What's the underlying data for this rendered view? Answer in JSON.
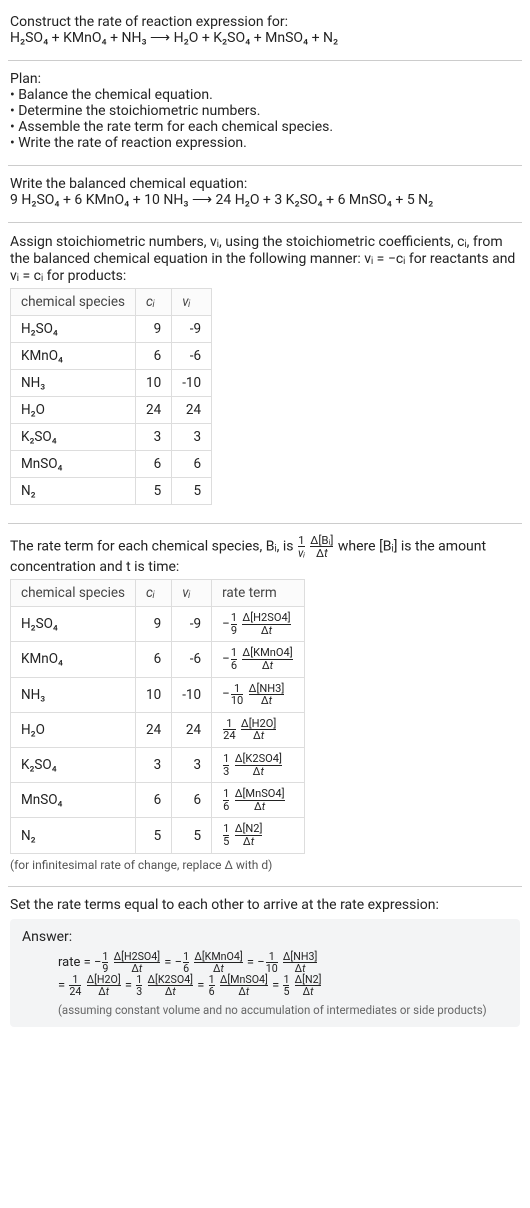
{
  "intro": {
    "prompt": "Construct the rate of reaction expression for:",
    "equation": "H₂SO₄ + KMnO₄ + NH₃  ⟶  H₂O + K₂SO₄ + MnSO₄ + N₂"
  },
  "plan": {
    "title": "Plan:",
    "items": [
      "• Balance the chemical equation.",
      "• Determine the stoichiometric numbers.",
      "• Assemble the rate term for each chemical species.",
      "• Write the rate of reaction expression."
    ]
  },
  "balanced": {
    "title": "Write the balanced chemical equation:",
    "equation": "9 H₂SO₄ + 6 KMnO₄ + 10 NH₃  ⟶  24 H₂O + 3 K₂SO₄ + 6 MnSO₄ + 5 N₂"
  },
  "assign": {
    "text": "Assign stoichiometric numbers, νᵢ, using the stoichiometric coefficients, cᵢ, from the balanced chemical equation in the following manner: νᵢ = −cᵢ for reactants and νᵢ = cᵢ for products:"
  },
  "table1": {
    "headers": [
      "chemical species",
      "cᵢ",
      "νᵢ"
    ],
    "rows": [
      {
        "species": "H₂SO₄",
        "c": "9",
        "v": "-9"
      },
      {
        "species": "KMnO₄",
        "c": "6",
        "v": "-6"
      },
      {
        "species": "NH₃",
        "c": "10",
        "v": "-10"
      },
      {
        "species": "H₂O",
        "c": "24",
        "v": "24"
      },
      {
        "species": "K₂SO₄",
        "c": "3",
        "v": "3"
      },
      {
        "species": "MnSO₄",
        "c": "6",
        "v": "6"
      },
      {
        "species": "N₂",
        "c": "5",
        "v": "5"
      }
    ]
  },
  "ratetermText": {
    "a": "The rate term for each chemical species, Bᵢ, is ",
    "b": " where [Bᵢ] is the amount concentration and t is time:"
  },
  "table2": {
    "headers": [
      "chemical species",
      "cᵢ",
      "νᵢ",
      "rate term"
    ],
    "rows": [
      {
        "species": "H₂SO₄",
        "c": "9",
        "v": "-9",
        "sign": "−",
        "fn": "1",
        "fd": "9",
        "delta": "Δ[H2SO4]"
      },
      {
        "species": "KMnO₄",
        "c": "6",
        "v": "-6",
        "sign": "−",
        "fn": "1",
        "fd": "6",
        "delta": "Δ[KMnO4]"
      },
      {
        "species": "NH₃",
        "c": "10",
        "v": "-10",
        "sign": "−",
        "fn": "1",
        "fd": "10",
        "delta": "Δ[NH3]"
      },
      {
        "species": "H₂O",
        "c": "24",
        "v": "24",
        "sign": "",
        "fn": "1",
        "fd": "24",
        "delta": "Δ[H2O]"
      },
      {
        "species": "K₂SO₄",
        "c": "3",
        "v": "3",
        "sign": "",
        "fn": "1",
        "fd": "3",
        "delta": "Δ[K2SO4]"
      },
      {
        "species": "MnSO₄",
        "c": "6",
        "v": "6",
        "sign": "",
        "fn": "1",
        "fd": "6",
        "delta": "Δ[MnSO4]"
      },
      {
        "species": "N₂",
        "c": "5",
        "v": "5",
        "sign": "",
        "fn": "1",
        "fd": "5",
        "delta": "Δ[N2]"
      }
    ],
    "footnote": "(for infinitesimal rate of change, replace Δ with d)"
  },
  "finalLine": "Set the rate terms equal to each other to arrive at the rate expression:",
  "answer": {
    "label": "Answer:",
    "ratePrefix": "rate =",
    "line1": [
      {
        "sign": "−",
        "fn": "1",
        "fd": "9",
        "delta": "Δ[H2SO4]"
      },
      {
        "sign": "−",
        "fn": "1",
        "fd": "6",
        "delta": "Δ[KMnO4]"
      },
      {
        "sign": "−",
        "fn": "1",
        "fd": "10",
        "delta": "Δ[NH3]"
      }
    ],
    "line2": [
      {
        "sign": "",
        "fn": "1",
        "fd": "24",
        "delta": "Δ[H2O]"
      },
      {
        "sign": "",
        "fn": "1",
        "fd": "3",
        "delta": "Δ[K2SO4]"
      },
      {
        "sign": "",
        "fn": "1",
        "fd": "6",
        "delta": "Δ[MnSO4]"
      },
      {
        "sign": "",
        "fn": "1",
        "fd": "5",
        "delta": "Δ[N2]"
      }
    ],
    "footnote": "(assuming constant volume and no accumulation of intermediates or side products)"
  }
}
